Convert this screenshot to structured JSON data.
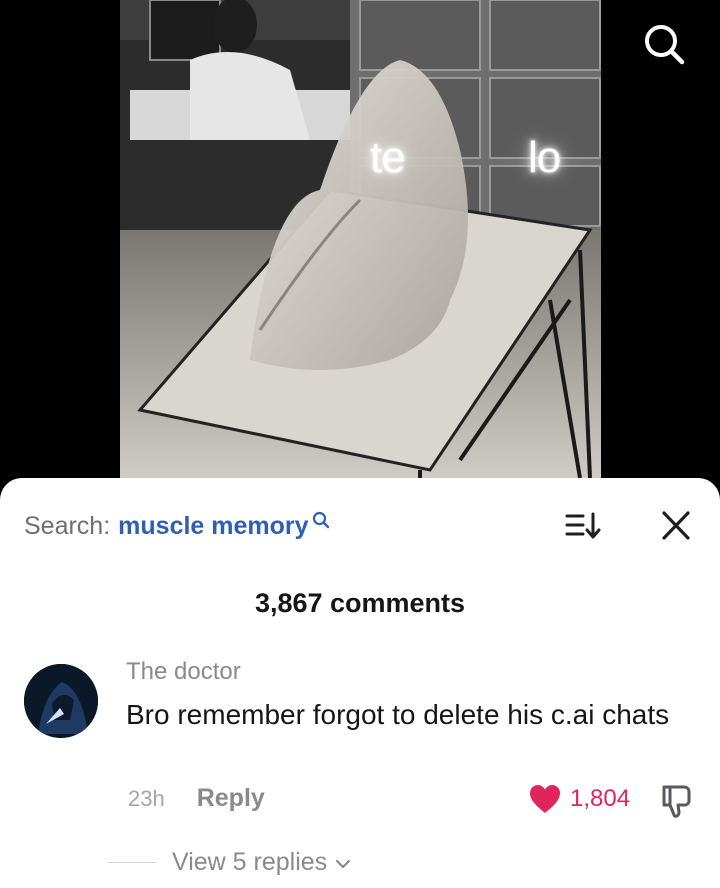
{
  "video": {
    "overlay_left": "te",
    "overlay_right": "lo",
    "search_icon": "search-icon"
  },
  "comments": {
    "search_prefix": "Search:",
    "search_term": "muscle memory",
    "count_label": "3,867 comments",
    "sort_icon": "sort-icon",
    "close_icon": "close-icon"
  },
  "comment": {
    "username": "The doctor",
    "text": "Bro remember forgot to delete his c.ai chats",
    "time": "23h",
    "reply_label": "Reply",
    "likes": "1,804",
    "view_replies": "View 5 replies"
  },
  "colors": {
    "accent_link": "#2f5fb3",
    "like": "#e0245e"
  }
}
